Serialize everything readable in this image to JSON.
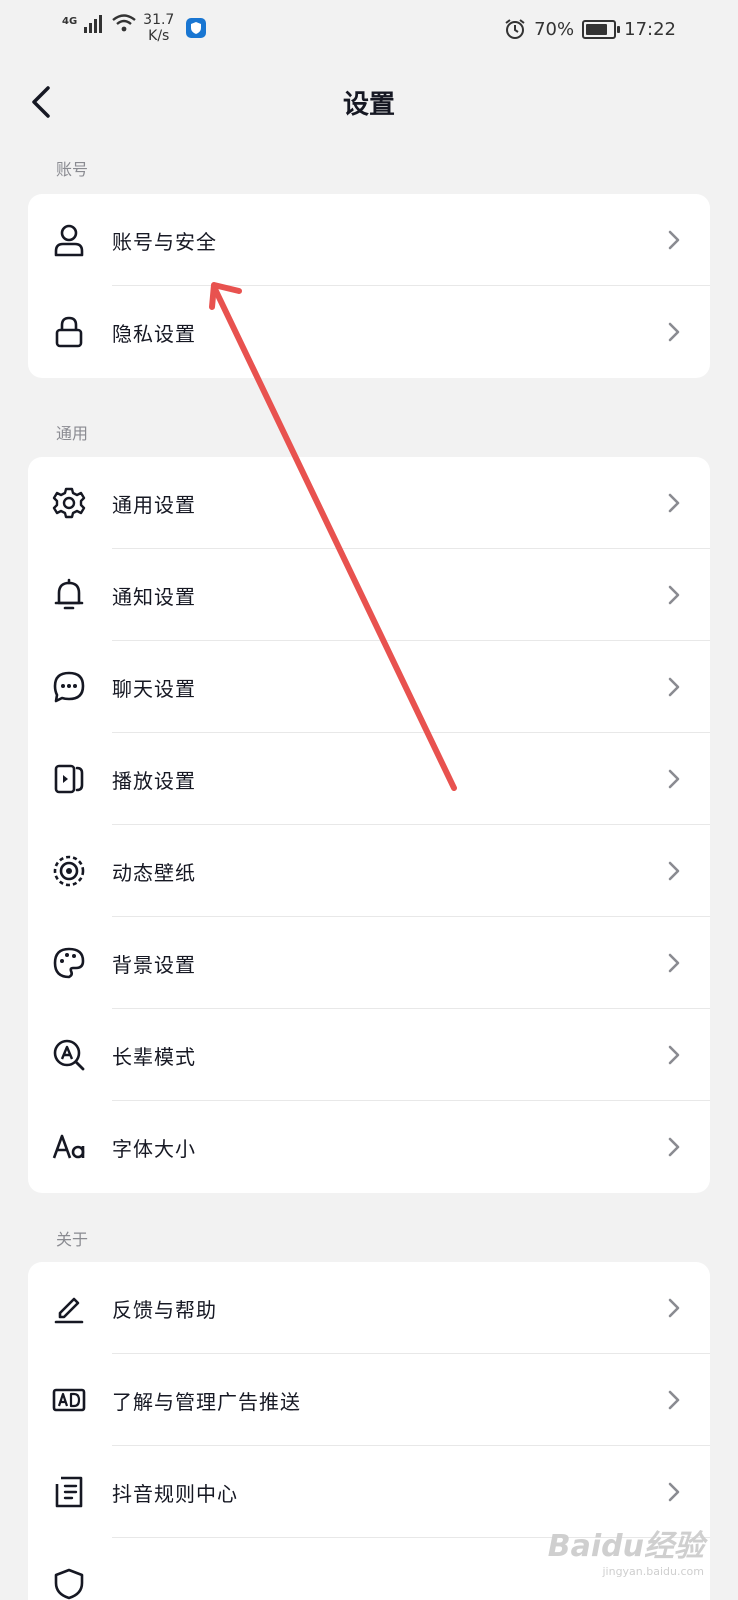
{
  "status_bar": {
    "network": "4G",
    "speed_value": "31.7",
    "speed_unit": "K/s",
    "battery": "70%",
    "time": "17:22"
  },
  "header": {
    "title": "设置",
    "back_icon": "back-arrow-icon"
  },
  "sections": [
    {
      "title": "账号",
      "items": [
        {
          "label": "账号与安全",
          "icon": "user-icon"
        },
        {
          "label": "隐私设置",
          "icon": "lock-icon"
        }
      ]
    },
    {
      "title": "通用",
      "items": [
        {
          "label": "通用设置",
          "icon": "gear-icon"
        },
        {
          "label": "通知设置",
          "icon": "bell-icon"
        },
        {
          "label": "聊天设置",
          "icon": "chat-bubble-icon"
        },
        {
          "label": "播放设置",
          "icon": "play-icon"
        },
        {
          "label": "动态壁纸",
          "icon": "wallpaper-icon"
        },
        {
          "label": "背景设置",
          "icon": "palette-icon"
        },
        {
          "label": "长辈模式",
          "icon": "elder-mode-icon"
        },
        {
          "label": "字体大小",
          "icon": "font-size-icon"
        }
      ]
    },
    {
      "title": "关于",
      "items": [
        {
          "label": "反馈与帮助",
          "icon": "edit-pen-icon"
        },
        {
          "label": "了解与管理广告推送",
          "icon": "ad-icon"
        },
        {
          "label": "抖音规则中心",
          "icon": "document-list-icon"
        }
      ]
    }
  ],
  "watermark": {
    "brand": "Baidu经验",
    "url": "jingyan.baidu.com"
  },
  "colors": {
    "background": "#f2f2f2",
    "card": "#ffffff",
    "text": "#161823",
    "section_label": "#8a8b91",
    "annotation": "#e8524f"
  }
}
